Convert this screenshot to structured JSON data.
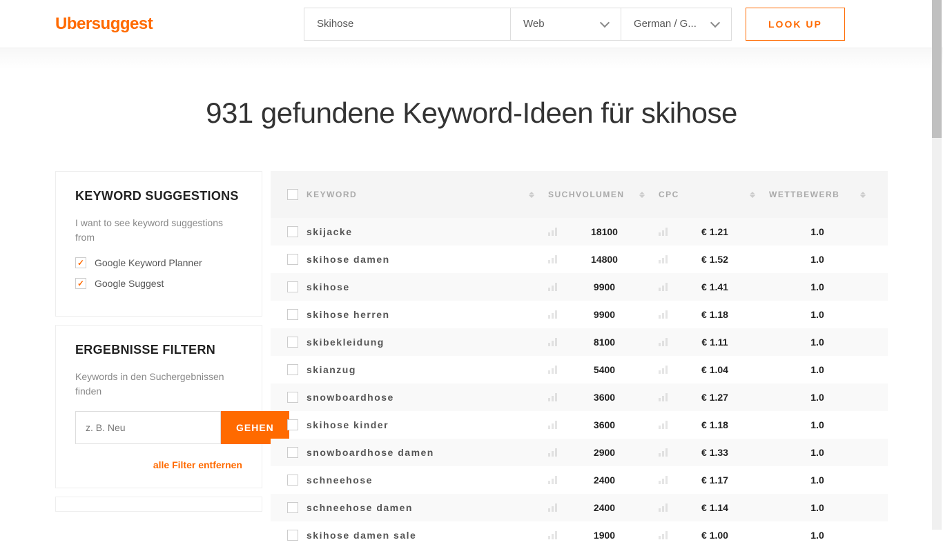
{
  "brand": "Ubersuggest",
  "search": {
    "value": "Skihose",
    "type": "Web",
    "lang": "German / G...",
    "lookup": "LOOK UP"
  },
  "title": "931 gefundene Keyword-Ideen für skihose",
  "sidebar": {
    "suggestions": {
      "title": "KEYWORD SUGGESTIONS",
      "sub": "I want to see keyword suggestions from",
      "opt1": "Google Keyword Planner",
      "opt2": "Google Suggest"
    },
    "filter": {
      "title": "ERGEBNISSE FILTERN",
      "sub": "Keywords in den Suchergebnissen finden",
      "placeholder": "z. B. Neu",
      "gehen": "GEHEN",
      "remove": "alle Filter entfernen"
    }
  },
  "columns": {
    "keyword": "KEYWORD",
    "volume": "SUCHVOLUMEN",
    "cpc": "CPC",
    "comp": "WETTBEWERB"
  },
  "rows": [
    {
      "kw": "skijacke",
      "vol": "18100",
      "cpc": "€ 1.21",
      "comp": "1.0"
    },
    {
      "kw": "skihose damen",
      "vol": "14800",
      "cpc": "€ 1.52",
      "comp": "1.0"
    },
    {
      "kw": "skihose",
      "vol": "9900",
      "cpc": "€ 1.41",
      "comp": "1.0"
    },
    {
      "kw": "skihose herren",
      "vol": "9900",
      "cpc": "€ 1.18",
      "comp": "1.0"
    },
    {
      "kw": "skibekleidung",
      "vol": "8100",
      "cpc": "€ 1.11",
      "comp": "1.0"
    },
    {
      "kw": "skianzug",
      "vol": "5400",
      "cpc": "€ 1.04",
      "comp": "1.0"
    },
    {
      "kw": "snowboardhose",
      "vol": "3600",
      "cpc": "€ 1.27",
      "comp": "1.0"
    },
    {
      "kw": "skihose kinder",
      "vol": "3600",
      "cpc": "€ 1.18",
      "comp": "1.0"
    },
    {
      "kw": "snowboardhose damen",
      "vol": "2900",
      "cpc": "€ 1.33",
      "comp": "1.0"
    },
    {
      "kw": "schneehose",
      "vol": "2400",
      "cpc": "€ 1.17",
      "comp": "1.0"
    },
    {
      "kw": "schneehose damen",
      "vol": "2400",
      "cpc": "€ 1.14",
      "comp": "1.0"
    },
    {
      "kw": "skihose damen sale",
      "vol": "1900",
      "cpc": "€ 1.00",
      "comp": "1.0"
    }
  ]
}
